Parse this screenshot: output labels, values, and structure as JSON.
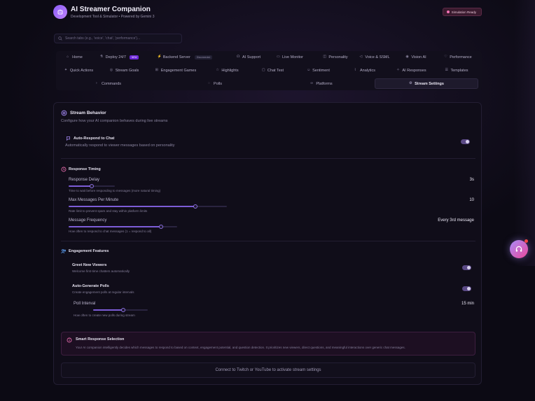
{
  "app": {
    "title": "AI Streamer Companion",
    "subtitle": "Development Tool & Simulator • Powered by Gemini 3",
    "status": "Simulation Ready"
  },
  "search": {
    "placeholder": "Search tabs (e.g., 'voice', 'chat', 'performance')..."
  },
  "tabs": {
    "row1": [
      {
        "label": "Home",
        "icon": "home-icon"
      },
      {
        "label": "Deploy 24/7",
        "icon": "flask-icon",
        "badge": "NEW"
      },
      {
        "label": "Backend Server",
        "icon": "bolt-icon",
        "badge": "Disconnected"
      },
      {
        "label": "AI Support",
        "icon": "headset-icon"
      },
      {
        "label": "Live Monitor",
        "icon": "monitor-icon"
      },
      {
        "label": "Personality",
        "icon": "mask-icon"
      },
      {
        "label": "Voice & SSML",
        "icon": "sound-icon"
      },
      {
        "label": "Vision AI",
        "icon": "eye-icon"
      },
      {
        "label": "Performance",
        "icon": "heart-icon"
      }
    ],
    "row2": [
      {
        "label": "Quick Actions",
        "icon": "sparkle-icon"
      },
      {
        "label": "Stream Goals",
        "icon": "target-icon"
      },
      {
        "label": "Engagement Games",
        "icon": "gamepad-icon"
      },
      {
        "label": "Highlights",
        "icon": "star-icon"
      },
      {
        "label": "Chat Test",
        "icon": "chat-icon"
      },
      {
        "label": "Sentiment",
        "icon": "smile-icon"
      },
      {
        "label": "Analytics",
        "icon": "chart-icon"
      },
      {
        "label": "AI Responses",
        "icon": "sparkle-icon"
      },
      {
        "label": "Templates",
        "icon": "template-icon"
      }
    ],
    "row3": [
      {
        "label": "Commands",
        "icon": "terminal-icon"
      },
      {
        "label": "Polls",
        "icon": "poll-icon"
      },
      {
        "label": "Platforms",
        "icon": "link-icon"
      },
      {
        "label": "Stream Settings",
        "icon": "gear-icon",
        "active": true
      }
    ]
  },
  "panel": {
    "title": "Stream Behavior",
    "subtitle": "Configure how your AI companion behaves during live streams",
    "auto_respond": {
      "title": "Auto-Respond to Chat",
      "desc": "Automatically respond to viewer messages based on personality",
      "enabled": true
    },
    "timing": {
      "title": "Response Timing",
      "items": [
        {
          "label": "Response Delay",
          "value": "3s",
          "help": "Time to wait before responding to messages (more natural timing)",
          "fill": 0.5
        },
        {
          "label": "Max Messages Per Minute",
          "value": "10",
          "help": "Rate limit to prevent spam and stay within platform limits",
          "fill": 0.8
        },
        {
          "label": "Message Frequency",
          "value": "Every 3rd message",
          "help": "How often to respond to chat messages (1 = respond to all)",
          "fill": 0.85
        }
      ]
    },
    "engagement": {
      "title": "Engagement Features",
      "greet": {
        "title": "Greet New Viewers",
        "desc": "Welcome first-time chatters automatically",
        "enabled": true
      },
      "polls": {
        "title": "Auto-Generate Polls",
        "desc": "Create engagement polls at regular intervals",
        "enabled": true
      },
      "poll_interval": {
        "label": "Poll Interval",
        "value": "15 min",
        "help": "How often to create new polls during stream",
        "fill": 0.55
      }
    },
    "smart": {
      "title": "Smart Response Selection",
      "desc": "Your AI companion intelligently decides which messages to respond to based on context, engagement potential, and question detection. It prioritizes new viewers, direct questions, and meaningful interactions over generic chat messages."
    },
    "footer": "Connect to Twitch or YouTube to activate stream settings"
  },
  "colors": {
    "accent": "#8b5cf6",
    "pink": "#ec4899",
    "background": "#0c0a14"
  }
}
